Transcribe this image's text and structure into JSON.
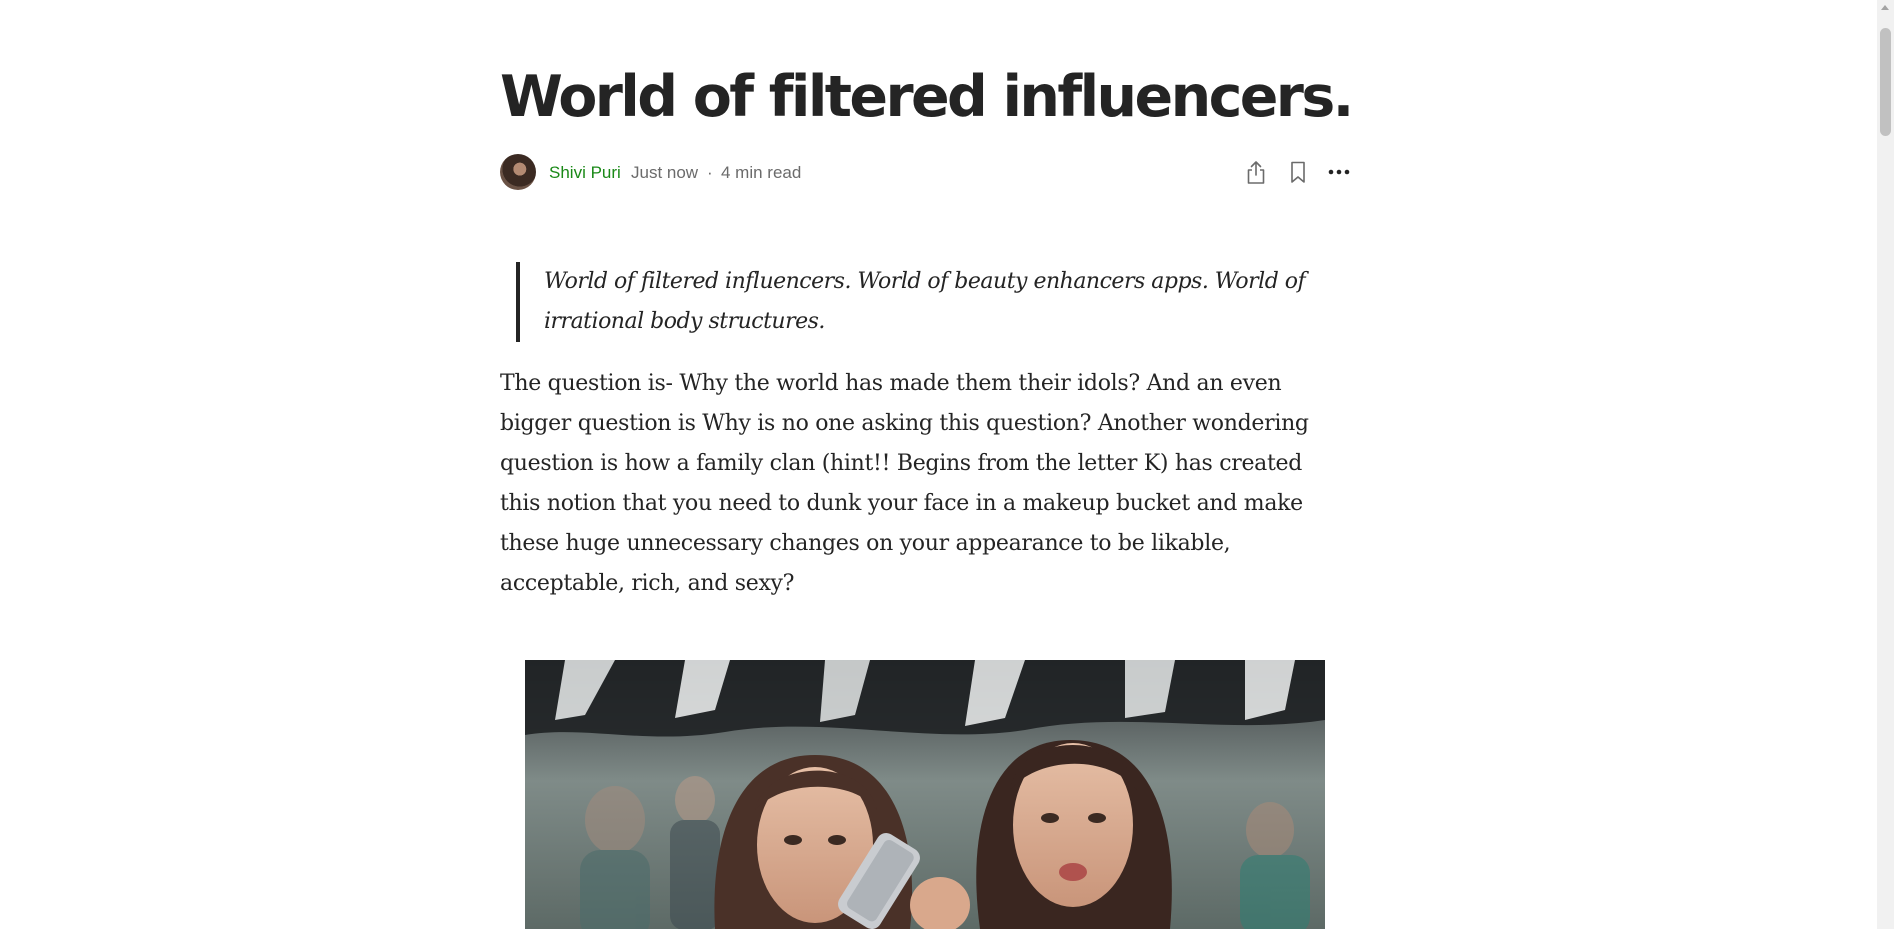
{
  "article": {
    "title": "World of filtered influencers.",
    "author": {
      "name": "Shivi Puri",
      "avatar_icon": "author-avatar"
    },
    "published": "Just now",
    "separator": "·",
    "read_time": "4 min read",
    "actions": {
      "share_icon": "share-icon",
      "bookmark_icon": "bookmark-icon",
      "more_icon": "more-options-icon"
    },
    "pullquote": "World of filtered influencers. World of beauty enhancers apps. World of irrational body structures.",
    "paragraph": "The question is- Why the world has made them their idols? And an even bigger question is Why is no one asking this question? Another wondering question is how a family clan (hint!! Begins from the letter K) has created this notion that you need to dunk your face in a makeup bucket and make these huge unnecessary changes on your appearance to be likable, acceptable, rich, and sexy?",
    "figure": {
      "description_icon": "article-photo"
    }
  },
  "colors": {
    "text": "#242424",
    "author": "#1a8917",
    "muted": "#6b6b6b",
    "scrollbar_track": "#f1f1f1",
    "scrollbar_thumb": "#c1c1c1"
  }
}
